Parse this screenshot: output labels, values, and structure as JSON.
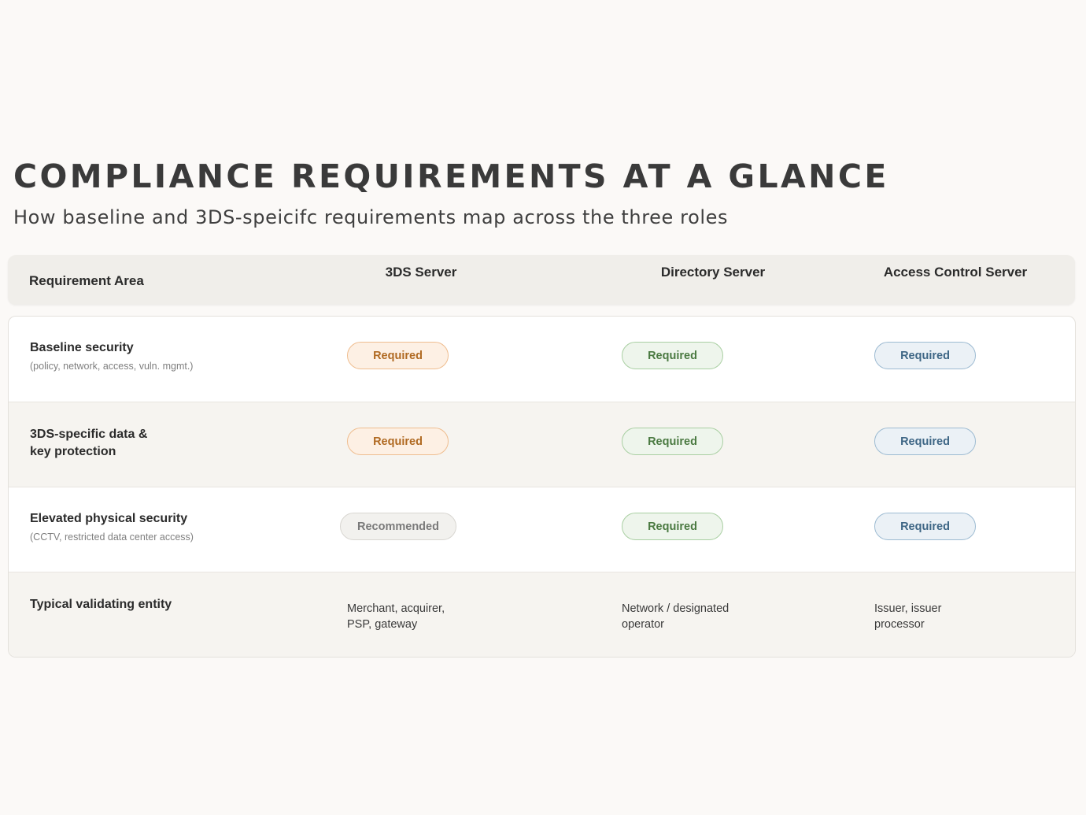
{
  "header": {
    "title": "COMPLIANCE REQUIREMENTS AT A GLANCE",
    "subtitle": "How baseline and 3DS-speicifc requirements map across the three roles"
  },
  "table": {
    "columns": {
      "area": "Requirement Area",
      "three_ds": "3DS Server",
      "ds": "Directory Server",
      "acs": "Access Control Server"
    },
    "rows": [
      {
        "label": "Baseline security",
        "sublabel": "(policy, network, access, vuln. mgmt.)",
        "three_ds": "Required",
        "ds": "Required",
        "acs": "Required"
      },
      {
        "label": "3DS-specific data & key protection",
        "sublabel": "",
        "three_ds": "Required",
        "ds": "Required",
        "acs": "Required"
      },
      {
        "label": "Elevated physical security",
        "sublabel": "(CCTV, restricted data center access)",
        "three_ds": "Recommended",
        "ds": "Required",
        "acs": "Required"
      },
      {
        "label": "Typical validating entity",
        "sublabel": "",
        "three_ds": "Merchant, acquirer, PSP, gateway",
        "ds": "Network / designated operator",
        "acs": "Issuer, issuer processor"
      }
    ]
  },
  "colors": {
    "three_ds_accent": "#efbd8f",
    "ds_accent": "#a9cfa2",
    "acs_accent": "#9dbbd2",
    "recommended_accent": "#d8d6d1"
  }
}
